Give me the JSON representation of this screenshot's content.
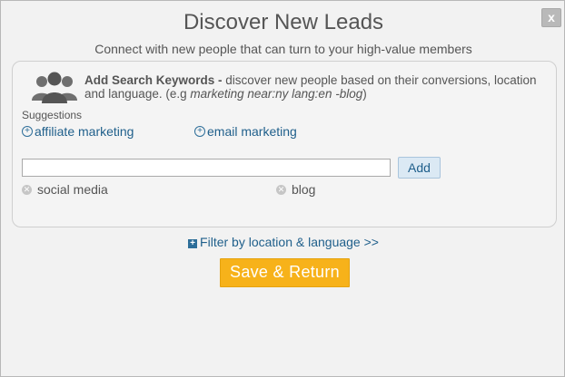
{
  "dialog": {
    "title": "Discover New Leads",
    "subtitle": "Connect with new people that can turn to your high-value members",
    "close_label": "x"
  },
  "instructions": {
    "heading": "Add Search Keywords -",
    "text": " discover new people based on their conversions, location and language. (e.g ",
    "example": "marketing near:ny lang:en -blog",
    "text_end": ")"
  },
  "suggestions": {
    "label": "Suggestions",
    "items": [
      {
        "label": "affiliate marketing"
      },
      {
        "label": "email marketing"
      }
    ]
  },
  "keyword_input": {
    "value": "",
    "placeholder": ""
  },
  "add_button": {
    "label": "Add"
  },
  "keywords": [
    {
      "label": "social media"
    },
    {
      "label": "blog"
    }
  ],
  "filter_link": {
    "label": "Filter by location & language >>"
  },
  "save_button": {
    "label": "Save & Return"
  },
  "colors": {
    "accent": "#f7b21a",
    "link": "#1f5f8b"
  },
  "icons": {
    "people": "people-group-icon",
    "plus": "plus-circle-icon",
    "remove": "remove-icon",
    "expand": "plus-box-icon"
  }
}
